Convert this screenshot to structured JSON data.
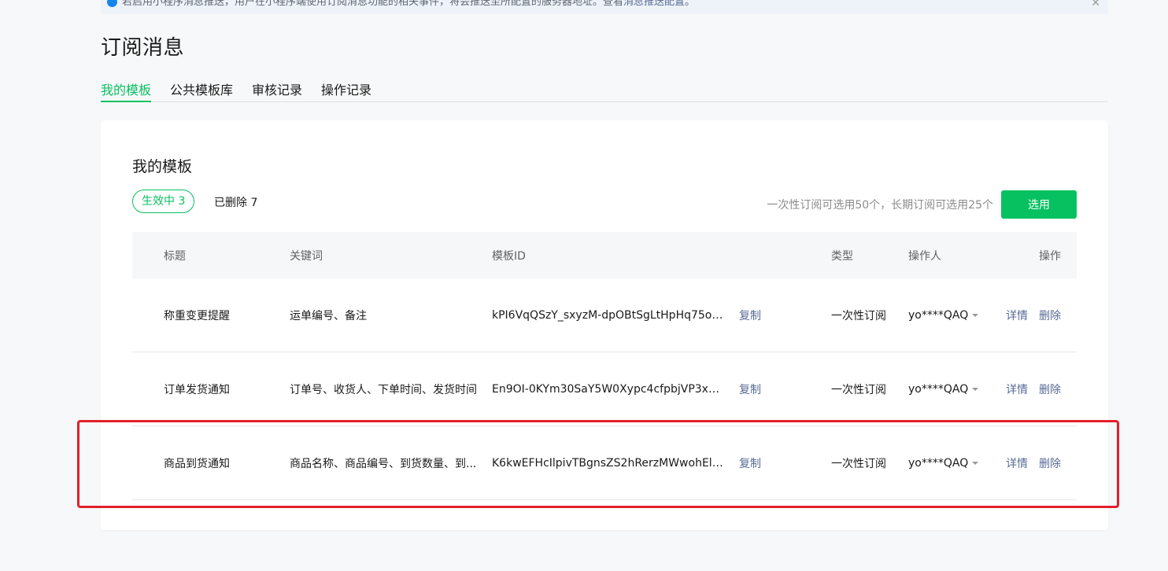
{
  "notice": {
    "text": "若启用小程序消息推送，用户在小程序端使用订阅消息功能的相关事件，将会推送至所配置的服务器地址。查看",
    "link": "消息推送配置",
    "link_suffix": "。"
  },
  "page_title": "订阅消息",
  "tabs": [
    {
      "label": "我的模板",
      "active": true
    },
    {
      "label": "公共模板库",
      "active": false
    },
    {
      "label": "审核记录",
      "active": false
    },
    {
      "label": "操作记录",
      "active": false
    }
  ],
  "card": {
    "title": "我的模板",
    "status_active": "生效中 3",
    "status_deleted": "已删除 7",
    "quota": "一次性订阅可选用50个，长期订阅可选用25个",
    "select_button": "选用"
  },
  "table": {
    "headers": {
      "title": "标题",
      "keywords": "关键词",
      "template_id": "模板ID",
      "type": "类型",
      "operator": "操作人",
      "actions": "操作"
    },
    "rows": [
      {
        "title": "称重变更提醒",
        "keywords": "运单编号、备注",
        "template_id": "kPI6VqQSzY_sxyzM-dpOBtSgLtHpHq75oZf...",
        "copy": "复制",
        "type": "一次性订阅",
        "operator": "yo****QAQ",
        "detail": "详情",
        "delete": "删除"
      },
      {
        "title": "订单发货通知",
        "keywords": "订单号、收货人、下单时间、发货时间",
        "template_id": "En9OI-0KYm30SaY5W0Xypc4cfpbjVP3xsiy...",
        "copy": "复制",
        "type": "一次性订阅",
        "operator": "yo****QAQ",
        "detail": "详情",
        "delete": "删除"
      },
      {
        "title": "商品到货通知",
        "keywords": "商品名称、商品编号、到货数量、到...",
        "template_id": "K6kwEFHcIlpivTBgnsZS2hRerzMWwohEllvm...",
        "copy": "复制",
        "type": "一次性订阅",
        "operator": "yo****QAQ",
        "detail": "详情",
        "delete": "删除"
      }
    ]
  },
  "colors": {
    "accent": "#07c160",
    "link": "#576b95",
    "highlight": "#e2202a"
  }
}
